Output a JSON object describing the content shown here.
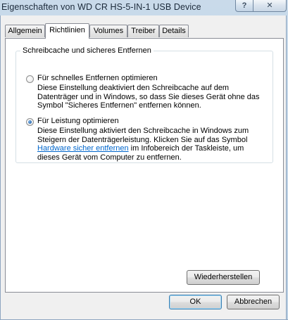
{
  "window": {
    "title": "Eigenschaften von WD CR    HS-5-IN-1 USB Device",
    "help_glyph": "?",
    "close_glyph": "✕"
  },
  "tabs": [
    {
      "label": "Allgemein",
      "active": false
    },
    {
      "label": "Richtlinien",
      "active": true
    },
    {
      "label": "Volumes",
      "active": false
    },
    {
      "label": "Treiber",
      "active": false
    },
    {
      "label": "Details",
      "active": false
    }
  ],
  "group": {
    "legend": "Schreibcache und sicheres Entfernen",
    "option1": {
      "label": "Für schnelles Entfernen optimieren",
      "selected": false,
      "desc_lines": [
        "Diese Einstellung deaktiviert den Schreibcache auf dem",
        "Datenträger und in Windows, so dass Sie dieses Gerät ohne das",
        "Symbol \"Sicheres Entfernen\" entfernen können."
      ]
    },
    "option2": {
      "label": "Für Leistung optimieren",
      "selected": true,
      "desc_line1": "Diese Einstellung aktiviert den Schreibcache in Windows zum",
      "desc_line2": "Steigern der Datenträgerleistung. Klicken Sie auf das Symbol",
      "desc_line3_link": "Hardware sicher entfernen",
      "desc_line3_rest": " im Infobereich der Taskleiste, um",
      "desc_line4": "dieses Gerät vom Computer zu entfernen."
    }
  },
  "buttons": {
    "restore": "Wiederherstellen",
    "ok": "OK",
    "cancel": "Abbrechen"
  }
}
